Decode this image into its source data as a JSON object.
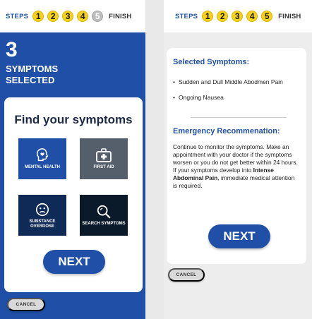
{
  "steps": {
    "label": "STEPS",
    "numbers": [
      "1",
      "2",
      "3",
      "4",
      "5"
    ],
    "finish": "FINISH"
  },
  "left": {
    "count": "3",
    "count_label": "SYMPTOMS SELECTED",
    "card_title": "Find your symptoms",
    "tiles": [
      {
        "label": "MENTAL HEALTH",
        "icon": "head-heart-icon"
      },
      {
        "label": "FIRST AID",
        "icon": "first-aid-kit-icon"
      },
      {
        "label": "SUBSTANCE OVERDOSE",
        "icon": "sick-face-icon"
      },
      {
        "label": "SEARCH SYMPTOMS",
        "icon": "search-symptoms-icon"
      }
    ],
    "next_label": "NEXT",
    "cancel_label": "CANCEL",
    "active_steps": 4
  },
  "right": {
    "selected_heading": "Selected Symptoms:",
    "symptoms": [
      "Sudden and Dull Middle Abodmen Pain",
      "Ongoing Nausea"
    ],
    "rec_heading": "Emergency Recommenation:",
    "rec_text_1": "Continue to monitor the symptoms. Make an appointment with your doctor if the symptoms worsen or you do not get better within 24 hours. If your symptoms develop into ",
    "rec_bold": "Intense Abdominal Pain",
    "rec_text_2": ", immediate medical attention is required.",
    "next_label": "NEXT",
    "cancel_label": "CANCEL",
    "active_steps": 5
  },
  "colors": {
    "brand_blue": "#1f4fa6",
    "step_yellow": "#f6d21a",
    "step_grey": "#bdbdbd",
    "navy": "#0f2a56"
  }
}
